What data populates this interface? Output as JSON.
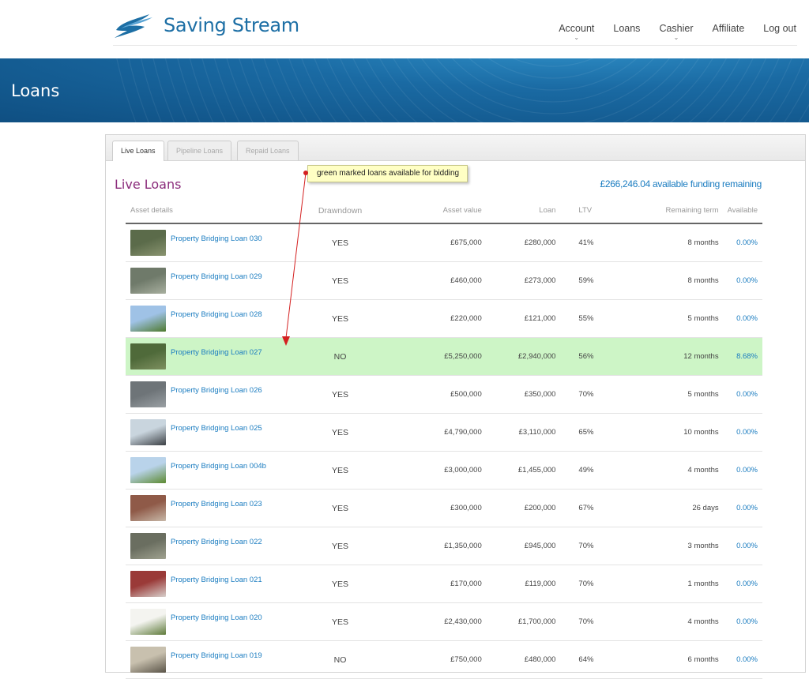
{
  "brand": {
    "name": "Saving Stream",
    "color": "#1d6fa5"
  },
  "nav": [
    {
      "label": "Account",
      "has_caret": true
    },
    {
      "label": "Loans",
      "has_caret": false
    },
    {
      "label": "Cashier",
      "has_caret": true
    },
    {
      "label": "Affiliate",
      "has_caret": false
    },
    {
      "label": "Log out",
      "has_caret": false
    }
  ],
  "banner": {
    "title": "Loans"
  },
  "tabs": [
    {
      "label": "Live Loans",
      "active": true
    },
    {
      "label": "Pipeline Loans",
      "active": false
    },
    {
      "label": "Repaid Loans",
      "active": false
    }
  ],
  "section": {
    "title": "Live Loans",
    "funding": "£266,246.04 available funding remaining"
  },
  "annotation": {
    "text": "green marked loans available for bidding"
  },
  "table": {
    "headers": [
      "Asset details",
      "Drawndown",
      "Asset value",
      "Loan",
      "LTV",
      "Remaining term",
      "Available"
    ],
    "rows": [
      {
        "name": "Property Bridging Loan 030",
        "drawndown": "YES",
        "asset_value": "£675,000",
        "loan": "£280,000",
        "ltv": "41%",
        "term": "8 months",
        "available": "0.00%",
        "highlight": false,
        "thumb": [
          "#5b6b4a",
          "#8a9470"
        ]
      },
      {
        "name": "Property Bridging Loan 029",
        "drawndown": "YES",
        "asset_value": "£460,000",
        "loan": "£273,000",
        "ltv": "59%",
        "term": "8 months",
        "available": "0.00%",
        "highlight": false,
        "thumb": [
          "#6f7a6a",
          "#a9b0a0"
        ]
      },
      {
        "name": "Property Bridging Loan 028",
        "drawndown": "YES",
        "asset_value": "£220,000",
        "loan": "£121,000",
        "ltv": "55%",
        "term": "5 months",
        "available": "0.00%",
        "highlight": false,
        "thumb": [
          "#9fc2e6",
          "#4f7a2e"
        ]
      },
      {
        "name": "Property Bridging Loan 027",
        "drawndown": "NO",
        "asset_value": "£5,250,000",
        "loan": "£2,940,000",
        "ltv": "56%",
        "term": "12 months",
        "available": "8.68%",
        "highlight": true,
        "thumb": [
          "#4f6a3a",
          "#7e9060"
        ]
      },
      {
        "name": "Property Bridging Loan 026",
        "drawndown": "YES",
        "asset_value": "£500,000",
        "loan": "£350,000",
        "ltv": "70%",
        "term": "5 months",
        "available": "0.00%",
        "highlight": false,
        "thumb": [
          "#6e7478",
          "#9aa0a4"
        ]
      },
      {
        "name": "Property Bridging Loan 025",
        "drawndown": "YES",
        "asset_value": "£4,790,000",
        "loan": "£3,110,000",
        "ltv": "65%",
        "term": "10 months",
        "available": "0.00%",
        "highlight": false,
        "thumb": [
          "#c9d5de",
          "#3b3f44"
        ]
      },
      {
        "name": "Property Bridging Loan 004b",
        "drawndown": "YES",
        "asset_value": "£3,000,000",
        "loan": "£1,455,000",
        "ltv": "49%",
        "term": "4 months",
        "available": "0.00%",
        "highlight": false,
        "thumb": [
          "#b9d3ea",
          "#5c8a30"
        ]
      },
      {
        "name": "Property Bridging Loan 023",
        "drawndown": "YES",
        "asset_value": "£300,000",
        "loan": "£200,000",
        "ltv": "67%",
        "term": "26 days",
        "available": "0.00%",
        "highlight": false,
        "thumb": [
          "#8f5a48",
          "#c8b8a8"
        ]
      },
      {
        "name": "Property Bridging Loan 022",
        "drawndown": "YES",
        "asset_value": "£1,350,000",
        "loan": "£945,000",
        "ltv": "70%",
        "term": "3 months",
        "available": "0.00%",
        "highlight": false,
        "thumb": [
          "#6a6e60",
          "#a0a290"
        ]
      },
      {
        "name": "Property Bridging Loan 021",
        "drawndown": "YES",
        "asset_value": "£170,000",
        "loan": "£119,000",
        "ltv": "70%",
        "term": "1 months",
        "available": "0.00%",
        "highlight": false,
        "thumb": [
          "#9a3a38",
          "#d8d0cc"
        ]
      },
      {
        "name": "Property Bridging Loan 020",
        "drawndown": "YES",
        "asset_value": "£2,430,000",
        "loan": "£1,700,000",
        "ltv": "70%",
        "term": "4 months",
        "available": "0.00%",
        "highlight": false,
        "thumb": [
          "#f4f4f0",
          "#5e7a3a"
        ]
      },
      {
        "name": "Property Bridging Loan 019",
        "drawndown": "NO",
        "asset_value": "£750,000",
        "loan": "£480,000",
        "ltv": "64%",
        "term": "6 months",
        "available": "0.00%",
        "highlight": false,
        "thumb": [
          "#c8c0ae",
          "#5a5448"
        ]
      }
    ]
  },
  "colors": {
    "link": "#1a7cc0",
    "title": "#8a2a7a",
    "highlight_row": "#cdf5c6",
    "annotation_arrow": "#d42020"
  }
}
